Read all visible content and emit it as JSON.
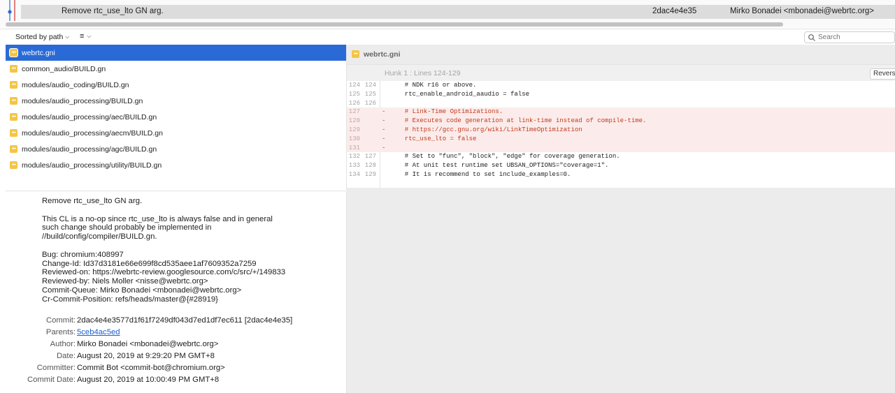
{
  "commit": {
    "message": "Remove rtc_use_lto GN arg.",
    "hash": "2dac4e4e35",
    "author": "Mirko Bonadei <mbonadei@webrtc.org>"
  },
  "toolbar": {
    "sort_label": "Sorted by path",
    "search_placeholder": "Search"
  },
  "files": [
    {
      "name": "webrtc.gni",
      "selected": true
    },
    {
      "name": "common_audio/BUILD.gn"
    },
    {
      "name": "modules/audio_coding/BUILD.gn"
    },
    {
      "name": "modules/audio_processing/BUILD.gn"
    },
    {
      "name": "modules/audio_processing/aec/BUILD.gn"
    },
    {
      "name": "modules/audio_processing/aecm/BUILD.gn"
    },
    {
      "name": "modules/audio_processing/agc/BUILD.gn"
    },
    {
      "name": "modules/audio_processing/utility/BUILD.gn"
    }
  ],
  "details": {
    "summary": "Remove rtc_use_lto GN arg.",
    "body_lines": [
      "This CL is a no-op since rtc_use_lto is always false and in general",
      "such change should probably be implemented in",
      "//build/config/compiler/BUILD.gn."
    ],
    "trailers": [
      "Bug: chromium:408997",
      "Change-Id: Id37d3181e66e699f8cd535aee1af7609352a7259",
      "Reviewed-on: https://webrtc-review.googlesource.com/c/src/+/149833",
      "Reviewed-by: Niels Moller <nisse@webrtc.org>",
      "Commit-Queue: Mirko Bonadei <mbonadei@webrtc.org>",
      "Cr-Commit-Position: refs/heads/master@{#28919}"
    ],
    "meta": [
      {
        "label": "Commit:",
        "value": "2dac4e4e3577d1f61f7249df043d7ed1df7ec611 [2dac4e4e35]"
      },
      {
        "label": "Parents:",
        "value": "5ceb4ac5ed",
        "link": true
      },
      {
        "label": "Author:",
        "value": "Mirko Bonadei <mbonadei@webrtc.org>"
      },
      {
        "label": "Date:",
        "value": "August 20, 2019 at 9:29:20 PM GMT+8"
      },
      {
        "label": "Committer:",
        "value": "Commit Bot <commit-bot@chromium.org>"
      },
      {
        "label": "Commit Date:",
        "value": "August 20, 2019 at 10:00:49 PM GMT+8"
      }
    ]
  },
  "diff": {
    "filename": "webrtc.gni",
    "hunk_title": "Hunk 1 : Lines 124-129",
    "reverse_label": "Reverse",
    "lines": [
      {
        "old": "124",
        "new": "124",
        "marker": "",
        "code": "  # NDK r16 or above.",
        "type": "context"
      },
      {
        "old": "125",
        "new": "125",
        "marker": "",
        "code": "  rtc_enable_android_aaudio = false",
        "type": "context"
      },
      {
        "old": "126",
        "new": "126",
        "marker": "",
        "code": "",
        "type": "context"
      },
      {
        "old": "127",
        "new": "",
        "marker": "-",
        "code": "  # Link-Time Optimizations.",
        "type": "removed"
      },
      {
        "old": "128",
        "new": "",
        "marker": "-",
        "code": "  # Executes code generation at link-time instead of compile-time.",
        "type": "removed"
      },
      {
        "old": "129",
        "new": "",
        "marker": "-",
        "code": "  # https://gcc.gnu.org/wiki/LinkTimeOptimization",
        "type": "removed"
      },
      {
        "old": "130",
        "new": "",
        "marker": "-",
        "code": "  rtc_use_lto = false",
        "type": "removed"
      },
      {
        "old": "131",
        "new": "",
        "marker": "-",
        "code": "",
        "type": "removed"
      },
      {
        "old": "132",
        "new": "127",
        "marker": "",
        "code": "  # Set to \"func\", \"block\", \"edge\" for coverage generation.",
        "type": "context"
      },
      {
        "old": "133",
        "new": "128",
        "marker": "",
        "code": "  # At unit test runtime set UBSAN_OPTIONS=\"coverage=1\".",
        "type": "context"
      },
      {
        "old": "134",
        "new": "129",
        "marker": "",
        "code": "  # It is recommend to set include_examples=0.",
        "type": "context"
      }
    ]
  }
}
